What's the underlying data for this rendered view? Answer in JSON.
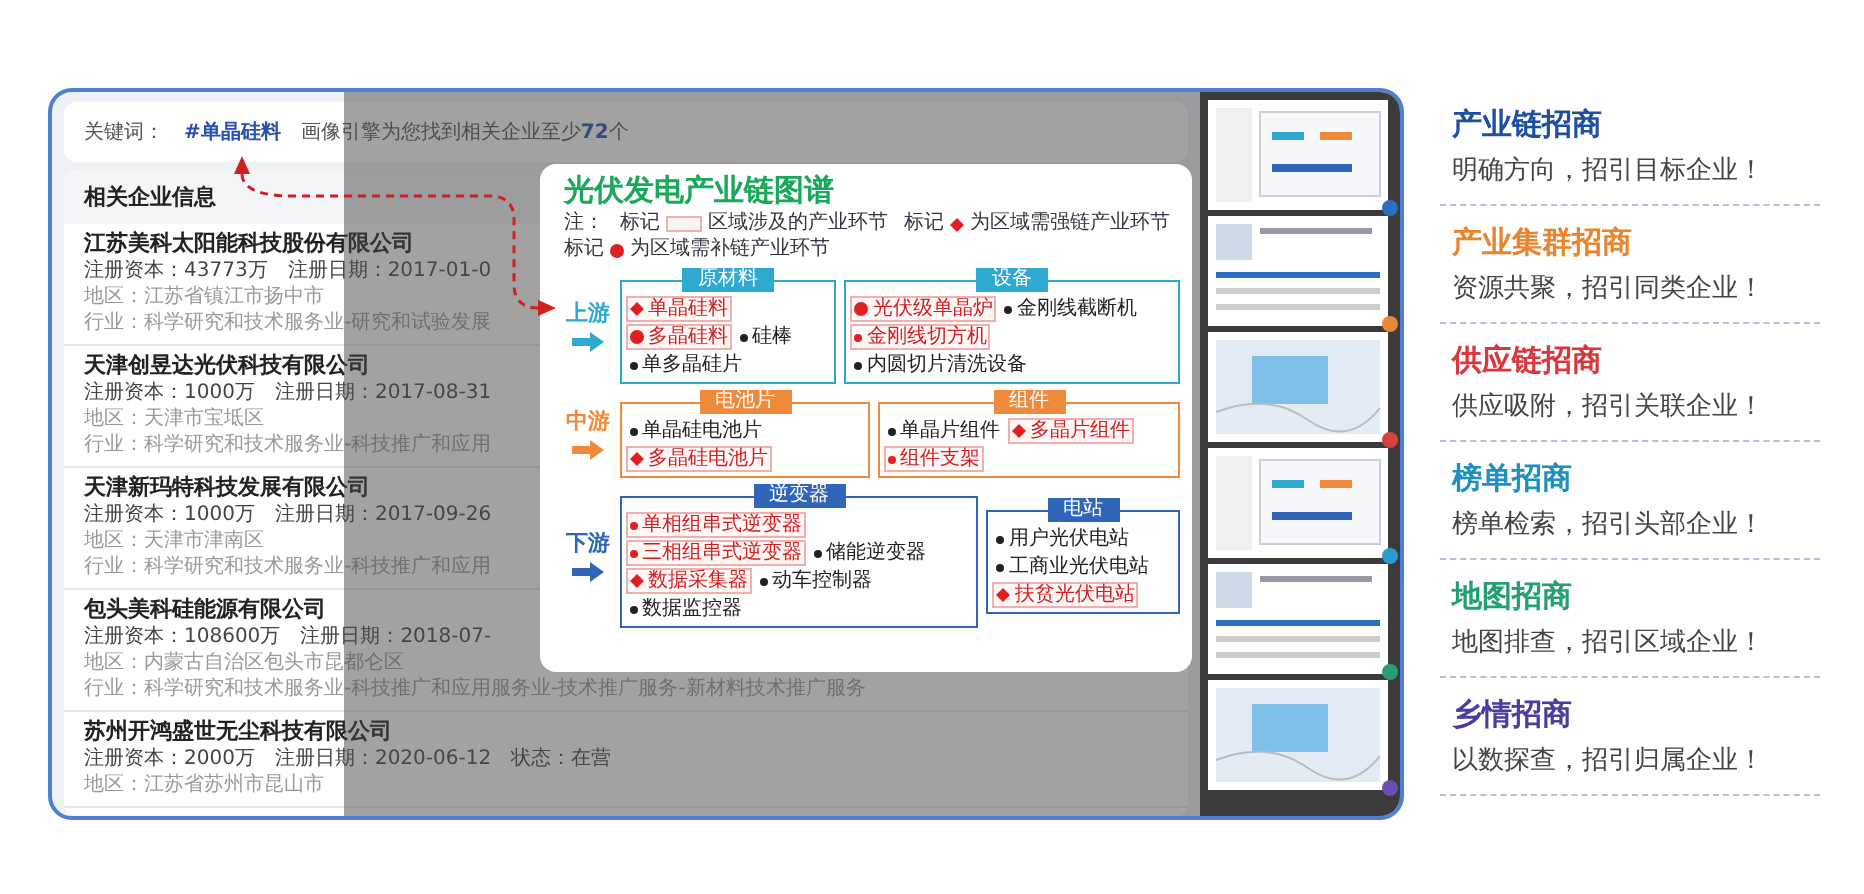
{
  "keyword_bar": {
    "label": "关键词：",
    "keyword": "#单晶硅料",
    "result": "画像引擎为您找到相关企业至少**72**个"
  },
  "company_panel": {
    "title": "相关企业信息",
    "companies": [
      {
        "name": "江苏美科太阳能科技股份有限公司",
        "capital": "注册资本：43773万",
        "date": "注册日期：2017-01-0",
        "region": "地区：江苏省镇江市扬中市",
        "industry": "行业：科学研究和技术服务业-研究和试验发展"
      },
      {
        "name": "天津创昱达光伏科技有限公司",
        "capital": "注册资本：1000万",
        "date": "注册日期：2017-08-31",
        "region": "地区：天津市宝坻区",
        "industry": "行业：科学研究和技术服务业-科技推广和应用"
      },
      {
        "name": "天津新玛特科技发展有限公司",
        "capital": "注册资本：1000万",
        "date": "注册日期：2017-09-26",
        "region": "地区：天津市津南区",
        "industry": "行业：科学研究和技术服务业-科技推广和应用"
      },
      {
        "name": "包头美科硅能源有限公司",
        "capital": "注册资本：108600万",
        "date": "注册日期：2018-07-",
        "region": "地区：内蒙古自治区包头市昆都仑区",
        "industry": "行业：科学研究和技术服务业-科技推广和应用服务业-技术推广服务-新材料技术推广服务"
      },
      {
        "name": "苏州开鸿盛世无尘科技有限公司",
        "capital": "注册资本：2000万",
        "date": "注册日期：2020-06-12",
        "status": "状态：在营",
        "region": "地区：江苏省苏州市昆山市"
      }
    ]
  },
  "chain_map": {
    "title": "光伏发电产业链图谱",
    "legend": [
      {
        "prefix": "注：",
        "kind": "text"
      },
      {
        "prefix": "标记",
        "kind": "swatch",
        "text": "区域涉及的产业环节"
      },
      {
        "prefix": "标记",
        "kind": "diamond",
        "text": "为区域需强链产业环节"
      },
      {
        "prefix": "标记",
        "kind": "circle",
        "text": "为区域需补链产业环节"
      }
    ],
    "tiers": [
      {
        "label": "上游",
        "color": "#2fa9d0",
        "groups": [
          {
            "title": "原材料",
            "items": [
              {
                "label": "单晶硅料",
                "kind": "diamond",
                "highlighted": true
              },
              {
                "label": "多晶硅料",
                "kind": "circle",
                "highlighted": true
              },
              {
                "label": "硅棒",
                "kind": "bullet",
                "highlighted": false
              },
              {
                "label": "单多晶硅片",
                "kind": "bullet",
                "highlighted": false
              }
            ]
          },
          {
            "title": "设备",
            "items": [
              {
                "label": "光伏级单晶炉",
                "kind": "circle",
                "highlighted": true
              },
              {
                "label": "金刚线截断机",
                "kind": "bullet",
                "highlighted": false
              },
              {
                "label": "金刚线切方机",
                "kind": "bullet",
                "highlighted": true
              },
              {
                "label": "内圆切片清洗设备",
                "kind": "bullet",
                "highlighted": false
              }
            ]
          }
        ]
      },
      {
        "label": "中游",
        "color": "#ef8a3c",
        "groups": [
          {
            "title": "电池片",
            "items": [
              {
                "label": "单晶硅电池片",
                "kind": "bullet",
                "highlighted": false
              },
              {
                "label": "多晶硅电池片",
                "kind": "diamond",
                "highlighted": true
              }
            ]
          },
          {
            "title": "组件",
            "items": [
              {
                "label": "单晶片组件",
                "kind": "bullet",
                "highlighted": false
              },
              {
                "label": "多晶片组件",
                "kind": "diamond",
                "highlighted": true
              },
              {
                "label": "组件支架",
                "kind": "bullet",
                "highlighted": true
              }
            ]
          }
        ]
      },
      {
        "label": "下游",
        "color": "#2f66b8",
        "groups": [
          {
            "title": "逆变器",
            "items": [
              {
                "label": "单相组串式逆变器",
                "kind": "bullet",
                "highlighted": true
              },
              {
                "label": "三相组串式逆变器",
                "kind": "bullet",
                "highlighted": true
              },
              {
                "label": "储能逆变器",
                "kind": "bullet",
                "highlighted": false
              },
              {
                "label": "数据采集器",
                "kind": "diamond",
                "highlighted": true
              },
              {
                "label": "动车控制器",
                "kind": "bullet",
                "highlighted": false
              },
              {
                "label": "数据监控器",
                "kind": "bullet",
                "highlighted": false
              }
            ]
          },
          {
            "title": "电站",
            "items": [
              {
                "label": "用户光伏电站",
                "kind": "bullet",
                "highlighted": false
              },
              {
                "label": "工商业光伏电站",
                "kind": "bullet",
                "highlighted": false
              },
              {
                "label": "扶贫光伏电站",
                "kind": "diamond",
                "highlighted": true
              }
            ]
          }
        ]
      }
    ]
  },
  "thumbnails": [
    {
      "color": "#2a6fc4"
    },
    {
      "color": "#e8883a"
    },
    {
      "color": "#d94040"
    },
    {
      "color": "#2a9ad0"
    },
    {
      "color": "#2aa070"
    },
    {
      "color": "#6a4fb0"
    }
  ],
  "features": [
    {
      "title": "产业链招商",
      "subtitle": "明确方向，招引目标企业！",
      "color": "#1f4f9e"
    },
    {
      "title": "产业集群招商",
      "subtitle": "资源共聚，招引同类企业！",
      "color": "#e8862f"
    },
    {
      "title": "供应链招商",
      "subtitle": "供应吸附，招引关联企业！",
      "color": "#d9363e"
    },
    {
      "title": "榜单招商",
      "subtitle": "榜单检索，招引头部企业！",
      "color": "#1f8fc0"
    },
    {
      "title": "地图招商",
      "subtitle": "地图排查，招引区域企业！",
      "color": "#23a070"
    },
    {
      "title": "乡情招商",
      "subtitle": "以数探查，招引归属企业！",
      "color": "#4b3d9e"
    }
  ]
}
